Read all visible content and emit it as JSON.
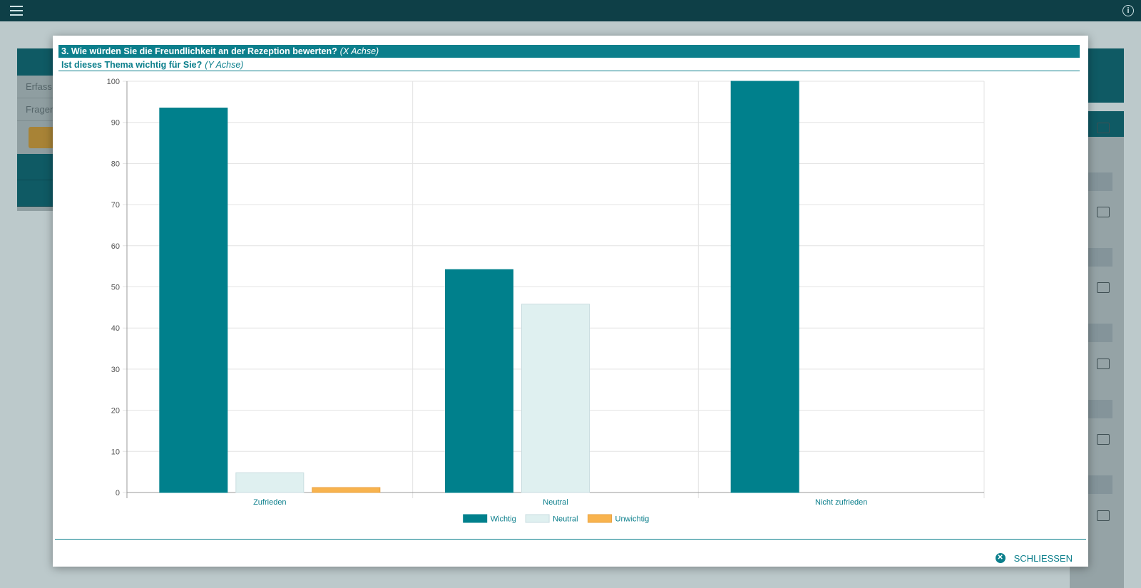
{
  "background": {
    "sidebar_rows": [
      "Erfass",
      "Fragen"
    ]
  },
  "modal": {
    "title": "3. Wie würden Sie die Freundlichkeit an der Rezeption bewerten?",
    "title_axis": "(X Achse)",
    "subtitle": "Ist dieses Thema wichtig für Sie?",
    "subtitle_axis": "(Y Achse)",
    "close_label": "SCHLIESSEN"
  },
  "colors": {
    "accent": "#0c7f8c",
    "wichtig": "#00808c",
    "neutral": "#dff0f0",
    "unwichtig": "#f8b34e"
  },
  "chart_data": {
    "type": "bar",
    "categories": [
      "Zufrieden",
      "Neutral",
      "Nicht zufrieden"
    ],
    "series": [
      {
        "name": "Wichtig",
        "values": [
          93.5,
          54.2,
          100
        ]
      },
      {
        "name": "Neutral",
        "values": [
          4.8,
          45.8,
          0
        ]
      },
      {
        "name": "Unwichtig",
        "values": [
          1.2,
          0,
          0
        ]
      }
    ],
    "ylim": [
      0,
      100
    ],
    "yticks": [
      0,
      10,
      20,
      30,
      40,
      50,
      60,
      70,
      80,
      90,
      100
    ],
    "grid": true,
    "legend": "bottom-center"
  }
}
